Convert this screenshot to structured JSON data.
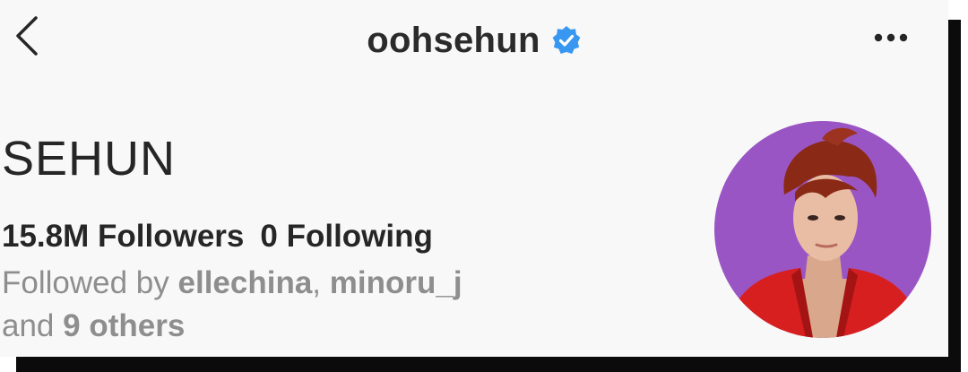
{
  "header": {
    "username": "oohsehun",
    "back_icon": "chevron-left-icon",
    "verified_icon": "verified-badge-icon",
    "more_icon": "more-horizontal-icon",
    "verified_color": "#3897f0"
  },
  "profile": {
    "display_name": "SEHUN",
    "followers_count": "15.8M",
    "followers_label": "Followers",
    "following_count": "0",
    "following_label": "Following",
    "followed_by_prefix": "Followed by",
    "followed_by_users": [
      "ellechina",
      "minoru_j"
    ],
    "followed_by_and": "and",
    "followed_by_others": "9 others"
  },
  "colors": {
    "background": "#f8f8f8",
    "text_primary": "#262626",
    "text_secondary": "#8e8e8e",
    "avatar_background": "#9a55c4",
    "avatar_jacket": "#d81f1f"
  }
}
